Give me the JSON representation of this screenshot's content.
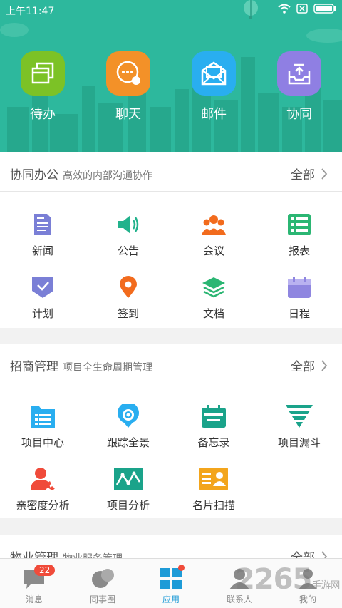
{
  "status_bar": {
    "time": "上午11:47"
  },
  "top_actions": [
    {
      "label": "待办",
      "color": "#7cc226",
      "icon": "window-stack-icon"
    },
    {
      "label": "聊天",
      "color": "#f39128",
      "icon": "chat-bubble-icon"
    },
    {
      "label": "邮件",
      "color": "#29aef0",
      "icon": "mail-icon"
    },
    {
      "label": "协同",
      "color": "#8f7fe3",
      "icon": "upload-tray-icon"
    }
  ],
  "sections": {
    "collab": {
      "title": "协同办公",
      "subtitle": "高效的内部沟通协作",
      "all_label": "全部",
      "items": [
        {
          "label": "新闻",
          "icon": "news-icon",
          "color": "#7a7fd6"
        },
        {
          "label": "公告",
          "icon": "megaphone-icon",
          "color": "#22b28c"
        },
        {
          "label": "会议",
          "icon": "people-icon",
          "color": "#f26b1d"
        },
        {
          "label": "报表",
          "icon": "list-icon",
          "color": "#2bb673"
        },
        {
          "label": "计划",
          "icon": "check-icon",
          "color": "#7a7fd6"
        },
        {
          "label": "签到",
          "icon": "location-pin-icon",
          "color": "#f26b1d"
        },
        {
          "label": "文档",
          "icon": "layers-icon",
          "color": "#2bb673"
        },
        {
          "label": "日程",
          "icon": "calendar-icon",
          "color": "#8f86e0"
        }
      ]
    },
    "invest": {
      "title": "招商管理",
      "subtitle": "项目全生命周期管理",
      "all_label": "全部",
      "items": [
        {
          "label": "项目中心",
          "icon": "folder-list-icon",
          "color": "#29aef0"
        },
        {
          "label": "跟踪全景",
          "icon": "panorama-pin-icon",
          "color": "#29aef0"
        },
        {
          "label": "备忘录",
          "icon": "memo-calendar-icon",
          "color": "#1aa38a"
        },
        {
          "label": "项目漏斗",
          "icon": "funnel-icon",
          "color": "#1aa38a"
        },
        {
          "label": "亲密度分析",
          "icon": "user-phone-icon",
          "color": "#f04b3a"
        },
        {
          "label": "项目分析",
          "icon": "line-chart-icon",
          "color": "#1aa38a"
        },
        {
          "label": "名片扫描",
          "icon": "business-card-icon",
          "color": "#f3a51c"
        }
      ]
    },
    "property": {
      "title": "物业管理",
      "subtitle": "物业服务管理",
      "all_label": "全部"
    }
  },
  "tabbar": {
    "tabs": [
      {
        "label": "消息",
        "badge": "22"
      },
      {
        "label": "同事圈"
      },
      {
        "label": "应用",
        "active": true
      },
      {
        "label": "联系人"
      },
      {
        "label": "我的"
      }
    ]
  },
  "watermark": {
    "text": "2265",
    "sub": "手游网"
  }
}
